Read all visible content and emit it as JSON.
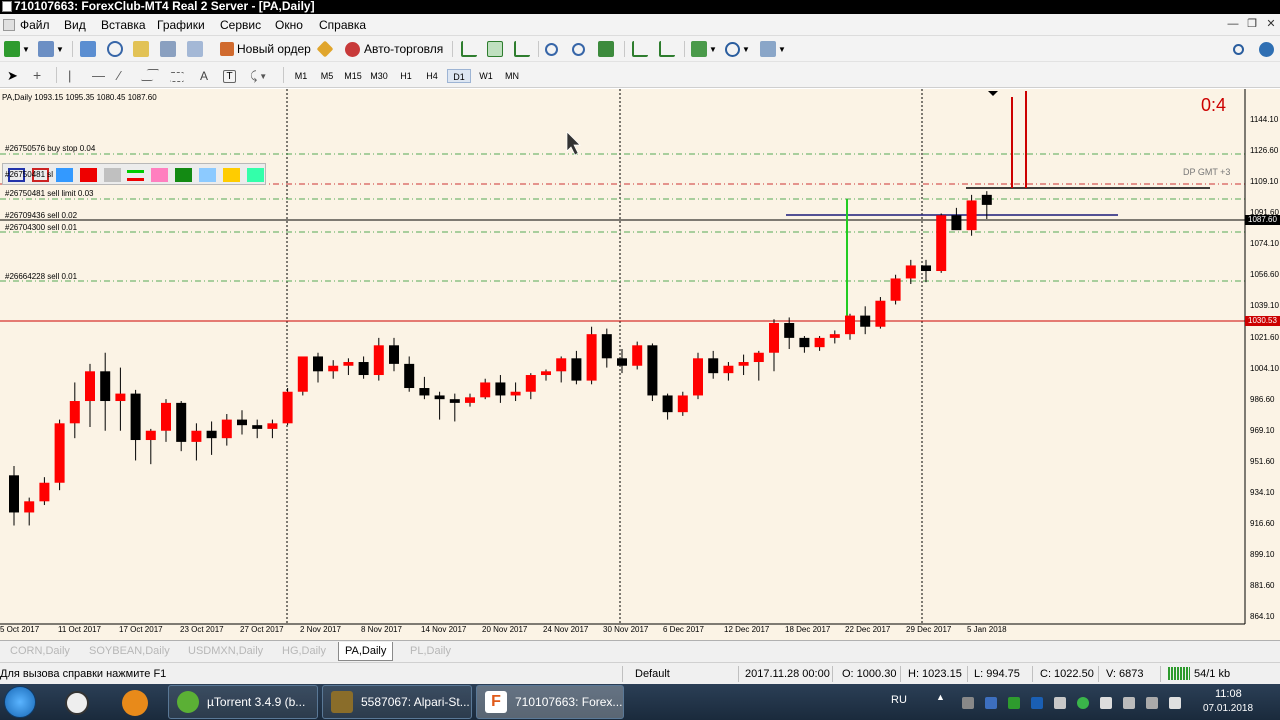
{
  "window": {
    "title": "710107663: ForexClub-MT4 Real 2 Server - [PA,Daily]"
  },
  "menu": {
    "items": [
      "Файл",
      "Вид",
      "Вставка",
      "Графики",
      "Сервис",
      "Окно",
      "Справка"
    ]
  },
  "toolbar": {
    "new_order_label": "Новый ордер",
    "auto_trading_label": "Авто-торговля",
    "timeframes": [
      "M1",
      "M5",
      "M15",
      "M30",
      "H1",
      "H4",
      "D1",
      "W1",
      "MN"
    ],
    "active_timeframe": "D1"
  },
  "chart": {
    "symbol_info": "PA,Daily  1093.15 1095.35 1080.45 1087.60",
    "score": "0:4",
    "dp_gmt": "DP GMT +3",
    "orders": [
      "#26750576 buy stop 0.04",
      "#26750481 sl",
      "#26750481 sell limit 0.03",
      "#26709436 sell 0.02",
      "#26704300 sell 0.01",
      "#26664228 sell 0.01"
    ],
    "price_scale": [
      "1144.10",
      "1126.60",
      "1109.10",
      "1091.60",
      "1074.10",
      "1056.60",
      "1039.10",
      "1021.60",
      "1004.10",
      "986.60",
      "969.10",
      "951.60",
      "934.10",
      "916.60",
      "899.10",
      "881.60",
      "864.10"
    ],
    "current_price": "1087.60",
    "level_price": "1030.53",
    "dates": [
      "5 Oct 2017",
      "11 Oct 2017",
      "17 Oct 2017",
      "23 Oct 2017",
      "27 Oct 2017",
      "2 Nov 2017",
      "8 Nov 2017",
      "14 Nov 2017",
      "20 Nov 2017",
      "24 Nov 2017",
      "30 Nov 2017",
      "6 Dec 2017",
      "12 Dec 2017",
      "18 Dec 2017",
      "22 Dec 2017",
      "29 Dec 2017",
      "5 Jan 2018"
    ],
    "colors": {
      "bull": "#ff0000",
      "bear": "#000000",
      "background": "#fbf3e5",
      "level": "#cc0000",
      "grid": "#55aa55"
    }
  },
  "chart_data": {
    "type": "candlestick",
    "symbol": "PA",
    "timeframe": "Daily",
    "ylim": [
      864.1,
      1150
    ],
    "ohlc": [
      [
        942,
        947,
        915,
        922
      ],
      [
        922,
        930,
        915,
        928
      ],
      [
        928,
        941,
        926,
        938
      ],
      [
        938,
        972,
        934,
        970
      ],
      [
        970,
        992,
        962,
        982
      ],
      [
        982,
        1002,
        968,
        998
      ],
      [
        998,
        1008,
        966,
        982
      ],
      [
        982,
        1000,
        966,
        986
      ],
      [
        986,
        988,
        950,
        961
      ],
      [
        961,
        967,
        948,
        966
      ],
      [
        966,
        983,
        960,
        981
      ],
      [
        981,
        982,
        955,
        960
      ],
      [
        960,
        970,
        950,
        966
      ],
      [
        966,
        971,
        953,
        962
      ],
      [
        962,
        975,
        958,
        972
      ],
      [
        972,
        977,
        964,
        969
      ],
      [
        969,
        972,
        962,
        967
      ],
      [
        967,
        972,
        962,
        970
      ],
      [
        970,
        989,
        969,
        987
      ],
      [
        987,
        1005,
        985,
        1006
      ],
      [
        1006,
        1008,
        992,
        998
      ],
      [
        998,
        1004,
        994,
        1001
      ],
      [
        1001,
        1005,
        996,
        1003
      ],
      [
        1003,
        1006,
        994,
        996
      ],
      [
        996,
        1016,
        993,
        1012
      ],
      [
        1012,
        1016,
        998,
        1002
      ],
      [
        1002,
        1006,
        987,
        989
      ],
      [
        989,
        995,
        983,
        985
      ],
      [
        985,
        987,
        972,
        983
      ],
      [
        983,
        986,
        971,
        981
      ],
      [
        981,
        986,
        979,
        984
      ],
      [
        984,
        994,
        983,
        992
      ],
      [
        992,
        996,
        981,
        985
      ],
      [
        985,
        992,
        982,
        987
      ],
      [
        987,
        997,
        983,
        996
      ],
      [
        996,
        999,
        993,
        998
      ],
      [
        998,
        1006,
        992,
        1005
      ],
      [
        1005,
        1009,
        991,
        993
      ],
      [
        993,
        1022,
        991,
        1018
      ],
      [
        1018,
        1021,
        1000,
        1005
      ],
      [
        1005,
        1010,
        997,
        1001
      ],
      [
        1001,
        1014,
        999,
        1012
      ],
      [
        1012,
        1013,
        982,
        985
      ],
      [
        985,
        986,
        972,
        976
      ],
      [
        976,
        987,
        974,
        985
      ],
      [
        985,
        1008,
        983,
        1005
      ],
      [
        1005,
        1009,
        994,
        997
      ],
      [
        997,
        1003,
        993,
        1001
      ],
      [
        1001,
        1007,
        996,
        1003
      ],
      [
        1003,
        1009,
        993,
        1008
      ],
      [
        1008,
        1026,
        998,
        1024
      ],
      [
        1024,
        1027,
        1010,
        1016
      ],
      [
        1016,
        1017,
        1008,
        1011
      ],
      [
        1011,
        1017,
        1009,
        1016
      ],
      [
        1016,
        1020,
        1013,
        1018
      ],
      [
        1018,
        1029,
        1015,
        1028
      ],
      [
        1028,
        1033,
        1018,
        1022
      ],
      [
        1022,
        1038,
        1021,
        1036
      ],
      [
        1036,
        1050,
        1034,
        1048
      ],
      [
        1048,
        1058,
        1045,
        1055
      ],
      [
        1055,
        1058,
        1046,
        1052
      ],
      [
        1052,
        1083,
        1051,
        1082
      ],
      [
        1082,
        1086,
        1076,
        1074
      ],
      [
        1074,
        1093,
        1071,
        1090
      ],
      [
        1093,
        1095,
        1080,
        1087.6
      ]
    ]
  },
  "tabs": [
    "CORN,Daily",
    "SOYBEAN,Daily",
    "USDMXN,Daily",
    "HG,Daily",
    "PA,Daily",
    "PL,Daily"
  ],
  "active_tab": "PA,Daily",
  "status": {
    "help": "Для вызова справки нажмите F1",
    "profile": "Default",
    "datetime": "2017.11.28 00:00",
    "open": "O: 1000.30",
    "high": "H: 1023.15",
    "low": "L: 994.75",
    "close": "C: 1022.50",
    "volume": "V: 6873",
    "traffic": "54/1 kb"
  },
  "taskbar": {
    "tasks": [
      "µTorrent 3.4.9  (b...",
      "5587067: Alpari-St...",
      "710107663: Forex..."
    ],
    "lang": "RU",
    "time": "11:08",
    "date": "07.01.2018"
  }
}
